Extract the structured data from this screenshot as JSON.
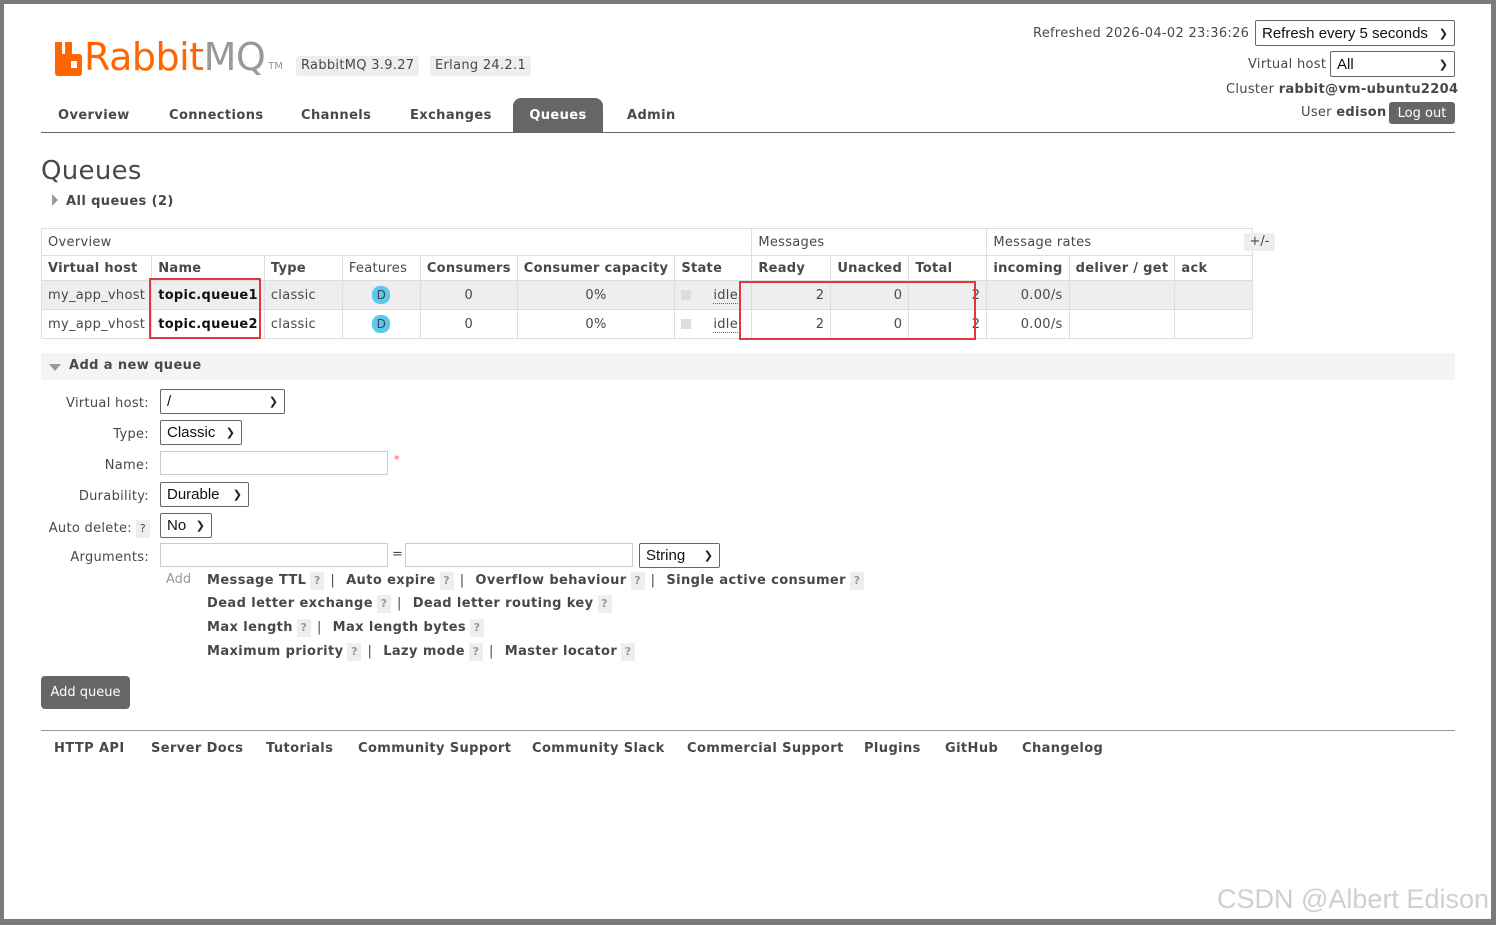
{
  "header": {
    "brand_rabbit": "Rabbit",
    "brand_mq": "MQ",
    "brand_tm": "TM",
    "rabbitmq_version": "RabbitMQ 3.9.27",
    "erlang_version": "Erlang 24.2.1",
    "refreshed_text": "Refreshed 2026-04-02 23:36:26",
    "refresh_select": "Refresh every 5 seconds",
    "vhost_label": "Virtual host",
    "vhost_select": "All",
    "cluster_label": "Cluster",
    "cluster_name": "rabbit@vm-ubuntu2204",
    "user_label": "User",
    "user_name": "edison",
    "logout_label": "Log out"
  },
  "tabs": [
    "Overview",
    "Connections",
    "Channels",
    "Exchanges",
    "Queues",
    "Admin"
  ],
  "active_tab": "Queues",
  "page_title": "Queues",
  "all_queues_label": "All queues (2)",
  "table": {
    "group_overview": "Overview",
    "group_messages": "Messages",
    "group_rates": "Message rates",
    "plus_minus": "+/-",
    "columns": [
      "Virtual host",
      "Name",
      "Type",
      "Features",
      "Consumers",
      "Consumer capacity",
      "State",
      "Ready",
      "Unacked",
      "Total",
      "incoming",
      "deliver / get",
      "ack"
    ],
    "rows": [
      {
        "vhost": "my_app_vhost",
        "name": "topic.queue1",
        "type": "classic",
        "feature": "D",
        "consumers": "0",
        "capacity": "0%",
        "state": "idle",
        "ready": "2",
        "unacked": "0",
        "total": "2",
        "incoming": "0.00/s",
        "deliver_get": "",
        "ack": ""
      },
      {
        "vhost": "my_app_vhost",
        "name": "topic.queue2",
        "type": "classic",
        "feature": "D",
        "consumers": "0",
        "capacity": "0%",
        "state": "idle",
        "ready": "2",
        "unacked": "0",
        "total": "2",
        "incoming": "0.00/s",
        "deliver_get": "",
        "ack": ""
      }
    ]
  },
  "add_queue": {
    "section_label": "Add a new queue",
    "vhost_label": "Virtual host:",
    "vhost_value": "/",
    "type_label": "Type:",
    "type_value": "Classic",
    "name_label": "Name:",
    "name_value": "",
    "required_mark": "*",
    "durability_label": "Durability:",
    "durability_value": "Durable",
    "autodelete_label": "Auto delete:",
    "autodelete_value": "No",
    "arguments_label": "Arguments:",
    "equals": "=",
    "arg_type_value": "String",
    "add_label": "Add",
    "help_mark": "?",
    "arg_links": [
      "Message TTL",
      "Auto expire",
      "Overflow behaviour",
      "Single active consumer",
      "Dead letter exchange",
      "Dead letter routing key",
      "Max length",
      "Max length bytes",
      "Maximum priority",
      "Lazy mode",
      "Master locator"
    ],
    "submit_label": "Add queue"
  },
  "footer_links": [
    "HTTP API",
    "Server Docs",
    "Tutorials",
    "Community Support",
    "Community Slack",
    "Commercial Support",
    "Plugins",
    "GitHub",
    "Changelog"
  ],
  "watermark": "CSDN @Albert Edison",
  "colors": {
    "brand_orange": "#ff6600",
    "highlight_red": "#e0393b",
    "feature_badge": "#5bc8f0",
    "tab_active": "#666666"
  }
}
